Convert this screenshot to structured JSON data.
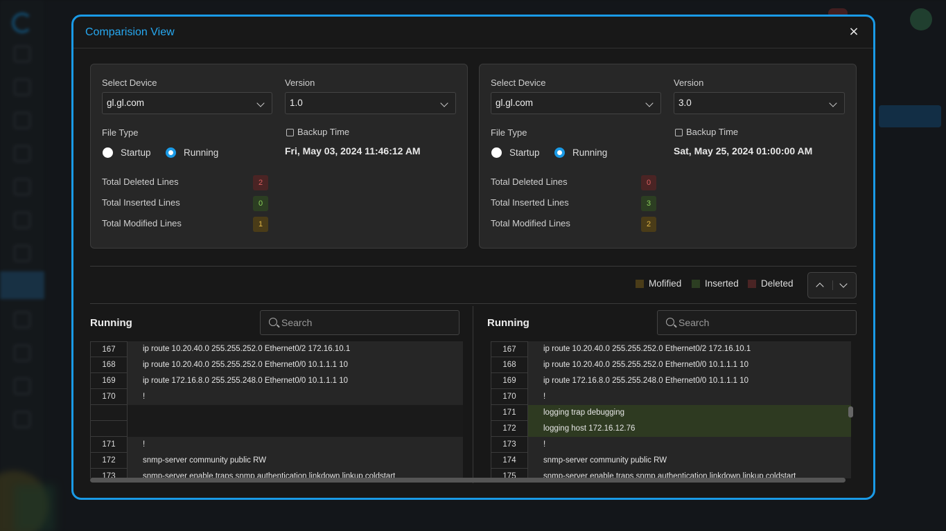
{
  "modal": {
    "title": "Comparision View",
    "close_label": "×"
  },
  "left": {
    "select_device_label": "Select Device",
    "device_value": "gl.gl.com",
    "version_label": "Version",
    "version_value": "1.0",
    "file_type_label": "File Type",
    "startup_label": "Startup",
    "running_label": "Running",
    "selected_file_type": "Running",
    "backup_time_label": "Backup Time",
    "backup_time_value": "Fri, May 03, 2024 11:46:12 AM",
    "deleted_label": "Total Deleted Lines",
    "deleted_count": "2",
    "inserted_label": "Total Inserted Lines",
    "inserted_count": "0",
    "modified_label": "Total Modified Lines",
    "modified_count": "1"
  },
  "right": {
    "select_device_label": "Select Device",
    "device_value": "gl.gl.com",
    "version_label": "Version",
    "version_value": "3.0",
    "file_type_label": "File Type",
    "startup_label": "Startup",
    "running_label": "Running",
    "selected_file_type": "Running",
    "backup_time_label": "Backup Time",
    "backup_time_value": "Sat, May 25, 2024 01:00:00 AM",
    "deleted_label": "Total Deleted Lines",
    "deleted_count": "0",
    "inserted_label": "Total Inserted Lines",
    "inserted_count": "3",
    "modified_label": "Total Modified Lines",
    "modified_count": "2"
  },
  "legend": {
    "modified_label": "Mofified",
    "inserted_label": "Inserted",
    "deleted_label": "Deleted",
    "modified_color": "#4a3c18",
    "inserted_color": "#2c3e22",
    "deleted_color": "#4a2424"
  },
  "left_pane": {
    "title": "Running",
    "search_placeholder": "Search",
    "lines": [
      {
        "num": "167",
        "text": "ip route 10.20.40.0 255.255.252.0 Ethernet0/2 172.16.10.1",
        "status": "normal"
      },
      {
        "num": "168",
        "text": "ip route 10.20.40.0 255.255.252.0 Ethernet0/0 10.1.1.1 10",
        "status": "normal"
      },
      {
        "num": "169",
        "text": "ip route 172.16.8.0 255.255.248.0 Ethernet0/0 10.1.1.1 10",
        "status": "normal"
      },
      {
        "num": "170",
        "text": "!",
        "status": "normal"
      },
      {
        "num": "",
        "text": "",
        "status": "blank"
      },
      {
        "num": "",
        "text": "",
        "status": "blank"
      },
      {
        "num": "171",
        "text": "!",
        "status": "normal"
      },
      {
        "num": "172",
        "text": "snmp-server community public RW",
        "status": "normal"
      },
      {
        "num": "173",
        "text": "snmp-server enable traps snmp authentication linkdown linkup coldstart",
        "status": "normal"
      }
    ]
  },
  "right_pane": {
    "title": "Running",
    "search_placeholder": "Search",
    "lines": [
      {
        "num": "167",
        "text": "ip route 10.20.40.0 255.255.252.0 Ethernet0/2 172.16.10.1",
        "status": "normal"
      },
      {
        "num": "168",
        "text": "ip route 10.20.40.0 255.255.252.0 Ethernet0/0 10.1.1.1 10",
        "status": "normal"
      },
      {
        "num": "169",
        "text": "ip route 172.16.8.0 255.255.248.0 Ethernet0/0 10.1.1.1 10",
        "status": "normal"
      },
      {
        "num": "170",
        "text": "!",
        "status": "normal"
      },
      {
        "num": "171",
        "text": "logging trap debugging",
        "status": "inserted"
      },
      {
        "num": "172",
        "text": "logging host 172.16.12.76",
        "status": "inserted"
      },
      {
        "num": "173",
        "text": "!",
        "status": "normal"
      },
      {
        "num": "174",
        "text": "snmp-server community public RW",
        "status": "normal"
      },
      {
        "num": "175",
        "text": "snmp-server enable traps snmp authentication linkdown linkup coldstart",
        "status": "normal"
      }
    ]
  }
}
